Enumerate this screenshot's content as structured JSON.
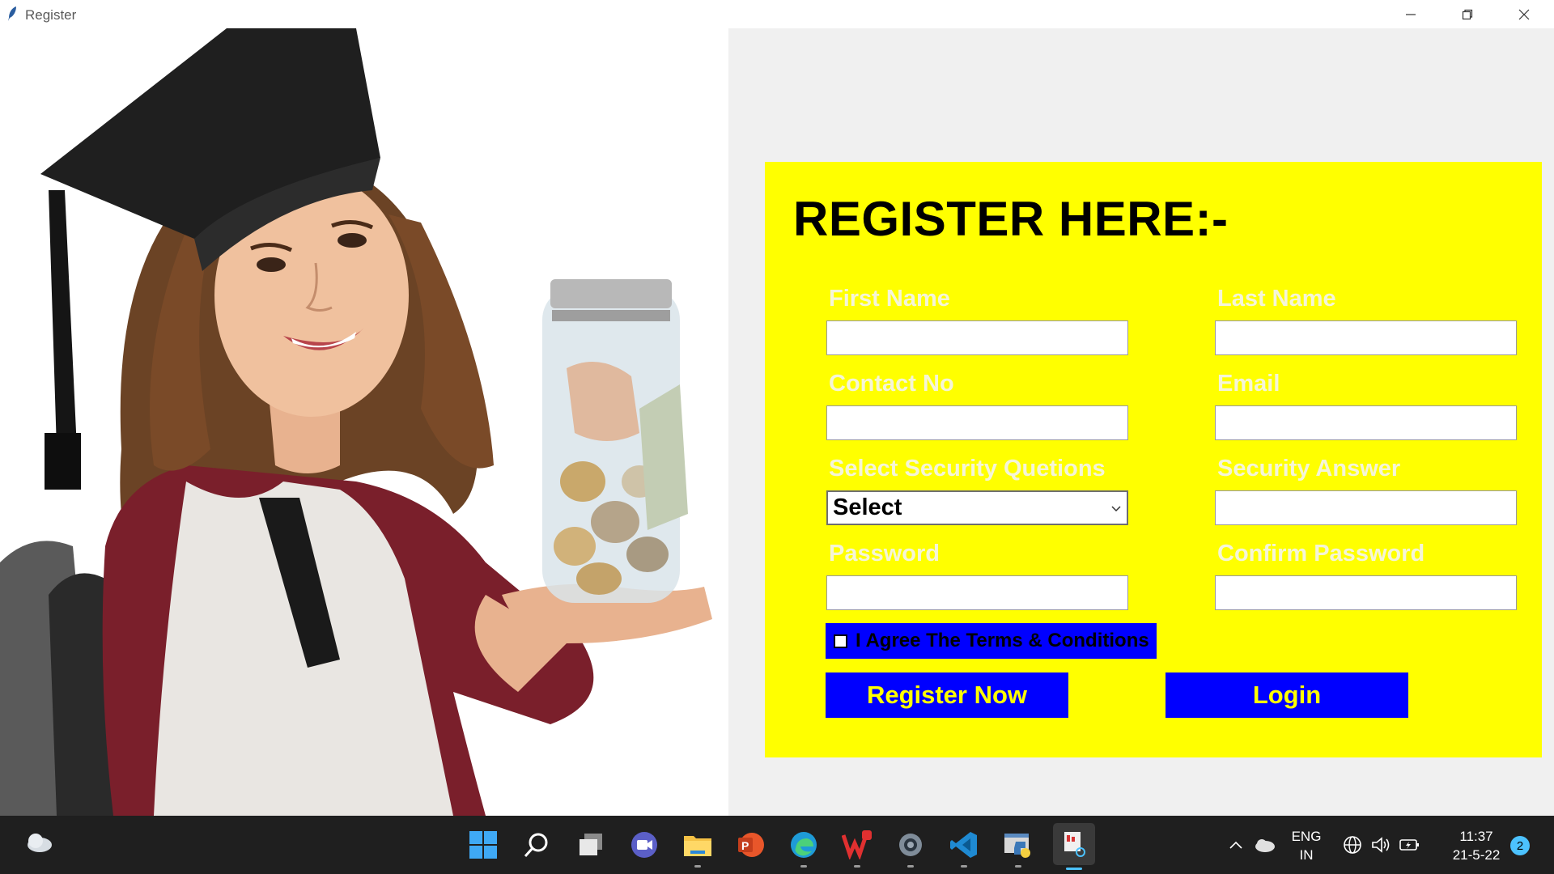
{
  "window": {
    "title": "Register"
  },
  "form": {
    "heading": "REGISTER HERE:-",
    "first_name_label": "First Name",
    "first_name_value": "",
    "last_name_label": "Last Name",
    "last_name_value": "",
    "contact_label": "Contact No",
    "contact_value": "",
    "email_label": "Email",
    "email_value": "",
    "security_question_label": "Select Security Quetions",
    "security_question_selected": "Select",
    "security_answer_label": "Security Answer",
    "security_answer_value": "",
    "password_label": "Password",
    "password_value": "",
    "confirm_password_label": "Confirm Password",
    "confirm_password_value": "",
    "terms_label": "I Agree The Terms & Conditions",
    "terms_checked": false,
    "register_button": "Register Now",
    "login_button": "Login"
  },
  "colors": {
    "card_background": "#ffff00",
    "button_background": "#0000ff",
    "button_text": "#ffff00",
    "right_background": "#f0f0f0",
    "taskbar": "#1f1f1f"
  },
  "taskbar": {
    "apps": [
      "weather-icon",
      "start-icon",
      "search-icon",
      "task-view-icon",
      "meet-icon",
      "file-explorer-icon",
      "powerpoint-icon",
      "edge-icon",
      "wps-icon",
      "settings-icon",
      "vscode-icon",
      "python-idle-icon",
      "snipping-tool-icon"
    ],
    "language_top": "ENG",
    "language_bottom": "IN",
    "time": "11:37",
    "date": "21-5-22",
    "notification_count": "2"
  }
}
